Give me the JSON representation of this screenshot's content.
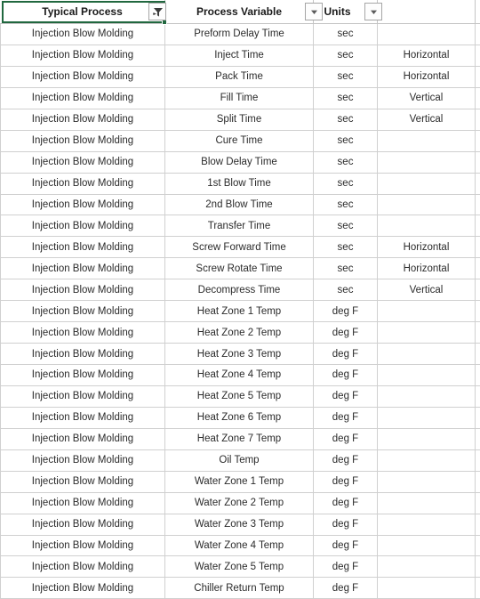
{
  "header": {
    "columns": [
      {
        "label": "Typical Process",
        "control": "filter-active-icon",
        "selected": true
      },
      {
        "label": "Process Variable",
        "control": "chevron-down-icon",
        "selected": false
      },
      {
        "label": "Units",
        "control": "chevron-down-icon",
        "selected": false
      },
      {
        "label": "",
        "control": "",
        "selected": false
      }
    ]
  },
  "table": {
    "columns": [
      "Typical Process",
      "Process Variable",
      "Units",
      ""
    ],
    "rows": [
      [
        "Injection Blow Molding",
        "Preform Delay Time",
        "sec",
        ""
      ],
      [
        "Injection Blow Molding",
        "Inject Time",
        "sec",
        "Horizontal"
      ],
      [
        "Injection Blow Molding",
        "Pack Time",
        "sec",
        "Horizontal"
      ],
      [
        "Injection Blow Molding",
        "Fill Time",
        "sec",
        "Vertical"
      ],
      [
        "Injection Blow Molding",
        "Split Time",
        "sec",
        "Vertical"
      ],
      [
        "Injection Blow Molding",
        "Cure Time",
        "sec",
        ""
      ],
      [
        "Injection Blow Molding",
        "Blow Delay Time",
        "sec",
        ""
      ],
      [
        "Injection Blow Molding",
        "1st Blow Time",
        "sec",
        ""
      ],
      [
        "Injection Blow Molding",
        "2nd Blow Time",
        "sec",
        ""
      ],
      [
        "Injection Blow Molding",
        "Transfer Time",
        "sec",
        ""
      ],
      [
        "Injection Blow Molding",
        "Screw Forward Time",
        "sec",
        "Horizontal"
      ],
      [
        "Injection Blow Molding",
        "Screw Rotate Time",
        "sec",
        "Horizontal"
      ],
      [
        "Injection Blow Molding",
        "Decompress Time",
        "sec",
        "Vertical"
      ],
      [
        "Injection Blow Molding",
        "Heat Zone 1 Temp",
        "deg F",
        ""
      ],
      [
        "Injection Blow Molding",
        "Heat Zone 2 Temp",
        "deg F",
        ""
      ],
      [
        "Injection Blow Molding",
        "Heat Zone 3 Temp",
        "deg F",
        ""
      ],
      [
        "Injection Blow Molding",
        "Heat Zone 4 Temp",
        "deg F",
        ""
      ],
      [
        "Injection Blow Molding",
        "Heat Zone 5 Temp",
        "deg F",
        ""
      ],
      [
        "Injection Blow Molding",
        "Heat Zone 6 Temp",
        "deg F",
        ""
      ],
      [
        "Injection Blow Molding",
        "Heat Zone 7 Temp",
        "deg F",
        ""
      ],
      [
        "Injection Blow Molding",
        "Oil Temp",
        "deg F",
        ""
      ],
      [
        "Injection Blow Molding",
        "Water Zone 1 Temp",
        "deg F",
        ""
      ],
      [
        "Injection Blow Molding",
        "Water Zone 2 Temp",
        "deg F",
        ""
      ],
      [
        "Injection Blow Molding",
        "Water Zone 3 Temp",
        "deg F",
        ""
      ],
      [
        "Injection Blow Molding",
        "Water Zone 4 Temp",
        "deg F",
        ""
      ],
      [
        "Injection Blow Molding",
        "Water Zone 5 Temp",
        "deg F",
        ""
      ],
      [
        "Injection Blow Molding",
        "Chiller Return Temp",
        "deg F",
        ""
      ]
    ]
  },
  "colors": {
    "selection_border": "#21683f",
    "gridline": "#d0d0d0",
    "header_gridline": "#c4c4c4",
    "text": "#2b2b2b",
    "header_text": "#1a1a1a",
    "background": "#ffffff"
  }
}
